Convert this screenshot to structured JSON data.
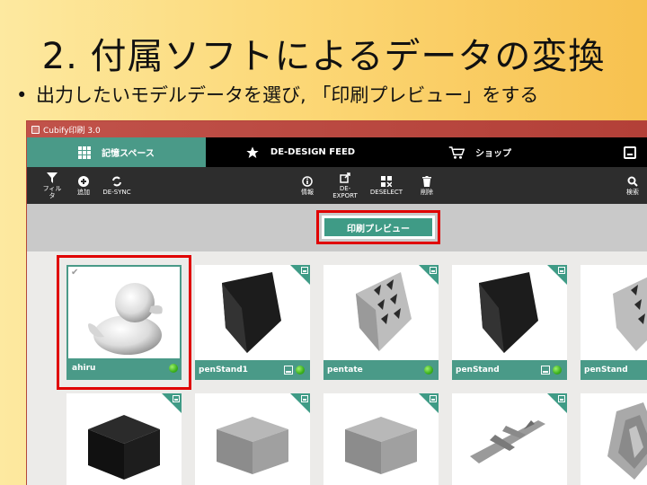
{
  "slide": {
    "title": "2. 付属ソフトによるデータの変換",
    "bullet": "出力したいモデルデータを選び, 「印刷プレビュー」をする",
    "bullet_marker": "•"
  },
  "app": {
    "window_title": "Cubify印刷 3.0",
    "tabs": [
      {
        "label": "記憶スペース",
        "icon": "grid-icon",
        "active": true
      },
      {
        "label": "DE-DESIGN FEED",
        "icon": "star-icon",
        "active": false
      },
      {
        "label": "ショップ",
        "icon": "cart-icon",
        "active": false
      }
    ],
    "toolbar": {
      "filter": "フィルタ",
      "add": "追加",
      "desync": "DE-SYNC",
      "info": "情報",
      "export": "DE-\nEXPORT",
      "deselect": "DESELECT",
      "delete": "削除",
      "search": "検索"
    },
    "preview_button": "印刷プレビュー",
    "models": [
      {
        "name": "ahiru",
        "kind": "duck",
        "selected": true,
        "status": "ok"
      },
      {
        "name": "penStand1",
        "kind": "stand-dark",
        "selected": false,
        "status": "ok",
        "extra_icon": true
      },
      {
        "name": "pentate",
        "kind": "stand-light",
        "selected": false,
        "status": "ok"
      },
      {
        "name": "penStand",
        "kind": "stand-dark",
        "selected": false,
        "status": "ok",
        "extra_icon": true
      },
      {
        "name": "penStand",
        "kind": "stand-light",
        "selected": false,
        "status": ""
      },
      {
        "name": "",
        "kind": "cube-dark"
      },
      {
        "name": "",
        "kind": "cube-gray"
      },
      {
        "name": "",
        "kind": "cube-gray"
      },
      {
        "name": "",
        "kind": "plane"
      },
      {
        "name": "",
        "kind": "ship"
      }
    ],
    "colors": {
      "accent": "#4a9a88",
      "title_bar": "#b34038",
      "highlight": "#e00000",
      "ok": "#3bb01c"
    }
  }
}
